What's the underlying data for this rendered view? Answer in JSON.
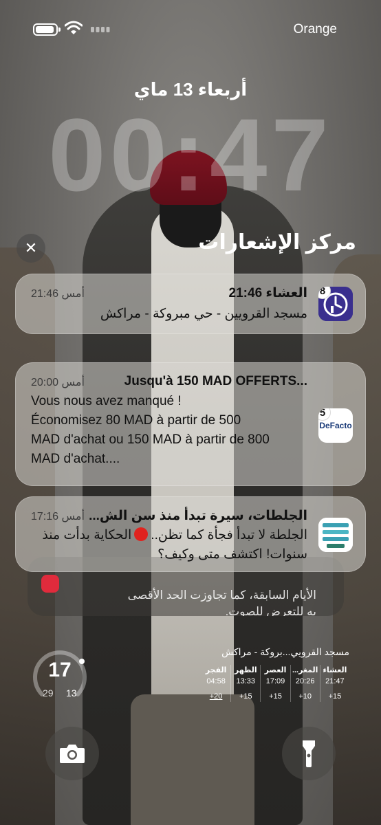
{
  "status_bar": {
    "carrier": "Orange"
  },
  "lock_screen": {
    "date": "أربعاء 13 ماي",
    "time": "00:47"
  },
  "notification_center": {
    "title": "مركز الإشعارات",
    "close_label": "✕"
  },
  "notifications": [
    {
      "app": "prayer-app",
      "badge": "8",
      "title": "العشاء 21:46",
      "time": "أمس 21:46",
      "body": "مسجد القرويين - حي مبروكة - مراكش"
    },
    {
      "app": "DeFacto",
      "icon_text": "DeFacto",
      "badge": "5",
      "title": "Jusqu'à 150 MAD OFFERTS...",
      "time": "أمس 20:00",
      "body_lines": [
        "Vous nous avez manqué !",
        "Économisez 80 MAD à partir de 500",
        "MAD d'achat ou 150 MAD à partir de 800",
        "MAD d'achat...."
      ]
    },
    {
      "app": "المعاني",
      "title": "الجلطات، سيرة تبدأ منذ سن الش...",
      "time": "أمس 17:16",
      "body_part1": "الجلطة لا تبدأ فجأة كما تظن..",
      "body_part2": "الحكاية بدأت منذ سنوات! اكتشف متى وكيف؟"
    }
  ],
  "stacked_notification": {
    "text_line1": "الأيام السابقة، كما تجاوزت الحد الأقصى",
    "text_line2": "به للتعرض للصوت."
  },
  "weather_widget": {
    "current": "17",
    "low": "29",
    "high": "13"
  },
  "prayer_widget": {
    "title": "مسجد القرويي...بروكة - مراكش",
    "prayers": [
      {
        "name": "الفجر",
        "time": "04:58",
        "diff": "+20"
      },
      {
        "name": "الظهر",
        "time": "13:33",
        "diff": "+15"
      },
      {
        "name": "العصر",
        "time": "17:09",
        "diff": "+15"
      },
      {
        "name": "المغر...",
        "time": "20:26",
        "diff": "+10"
      },
      {
        "name": "العشاء",
        "time": "21:47",
        "diff": "+15"
      }
    ]
  },
  "icons": {
    "battery": "battery-icon",
    "wifi": "wifi-icon",
    "signal": "signal-icon",
    "camera": "camera-icon",
    "flashlight": "flashlight-icon",
    "close": "close-icon"
  }
}
